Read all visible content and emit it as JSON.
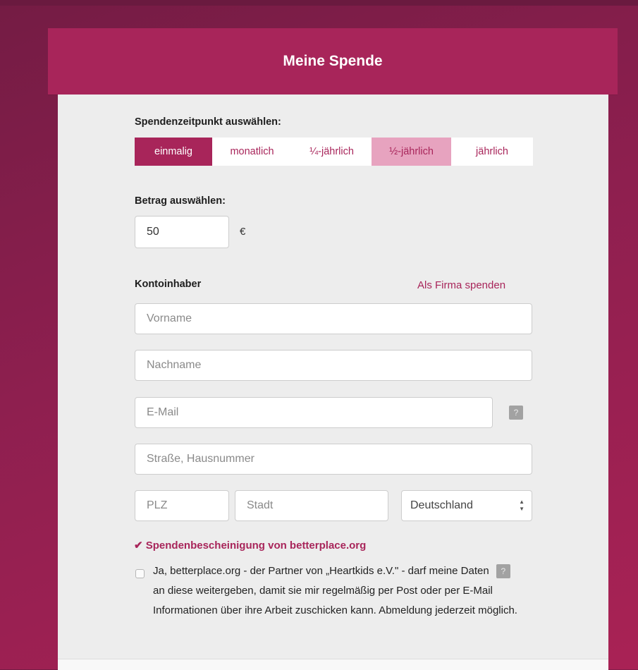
{
  "header": {
    "title": "Meine Spende"
  },
  "timing": {
    "label": "Spendenzeitpunkt auswählen:",
    "options": [
      {
        "label": "einmalig"
      },
      {
        "label": "monatlich"
      },
      {
        "label": "¼-jährlich"
      },
      {
        "label": "½-jährlich"
      },
      {
        "label": "jährlich"
      }
    ],
    "selected": "einmalig"
  },
  "amount": {
    "label": "Betrag auswählen:",
    "value": "50",
    "currency": "€"
  },
  "holder": {
    "label": "Kontoinhaber",
    "company_link": "Als Firma spenden",
    "fields": {
      "first_name_placeholder": "Vorname",
      "last_name_placeholder": "Nachname",
      "email_placeholder": "E-Mail",
      "street_placeholder": "Straße, Hausnummer",
      "zip_placeholder": "PLZ",
      "city_placeholder": "Stadt",
      "country_value": "Deutschland"
    },
    "help_glyph": "?"
  },
  "certificate": {
    "label": "Spendenbescheinigung von betterplace.org",
    "check_glyph": "✔"
  },
  "consent": {
    "text_before": "Ja, betterplace.org - der Partner von „Heartkids e.V.\" - darf meine Daten",
    "text_after": "an diese weitergeben, damit sie mir regelmäßig per Post oder per E-Mail Informationen über ihre Arbeit zuschicken kann. Abmeldung jederzeit möglich.",
    "checked": false
  },
  "colors": {
    "brand": "#a8255a",
    "brand_light": "#e7a3bf",
    "panel": "#ededed"
  }
}
